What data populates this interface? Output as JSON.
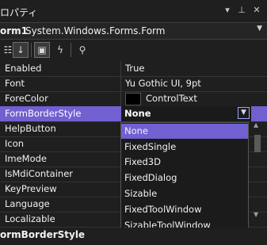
{
  "panel": {
    "title": "ロパティ"
  },
  "object_selector": {
    "name": "orm1",
    "type": "System.Windows.Forms.Form"
  },
  "toolbar": {
    "icons": [
      "categorized-icon",
      "alphabetical-icon",
      "properties-icon",
      "events-icon",
      "property-pages-icon"
    ]
  },
  "properties": [
    {
      "name": "Enabled",
      "value": "True"
    },
    {
      "name": "Font",
      "value": "Yu Gothic UI, 9pt"
    },
    {
      "name": "ForeColor",
      "value": "ControlText"
    },
    {
      "name": "FormBorderStyle",
      "value": "None"
    },
    {
      "name": "HelpButton",
      "value": ""
    },
    {
      "name": "Icon",
      "value": ""
    },
    {
      "name": "ImeMode",
      "value": ""
    },
    {
      "name": "IsMdiContainer",
      "value": ""
    },
    {
      "name": "KeyPreview",
      "value": ""
    },
    {
      "name": "Language",
      "value": ""
    },
    {
      "name": "Localizable",
      "value": ""
    }
  ],
  "dropdown": {
    "options": [
      "None",
      "FixedSingle",
      "Fixed3D",
      "FixedDialog",
      "Sizable",
      "FixedToolWindow",
      "SizableToolWindow"
    ],
    "selected": "None"
  },
  "description": {
    "title": "ormBorderStyle",
    "text": ""
  },
  "colors": {
    "accent": "#7060d0",
    "forecolor_swatch": "#000000"
  }
}
